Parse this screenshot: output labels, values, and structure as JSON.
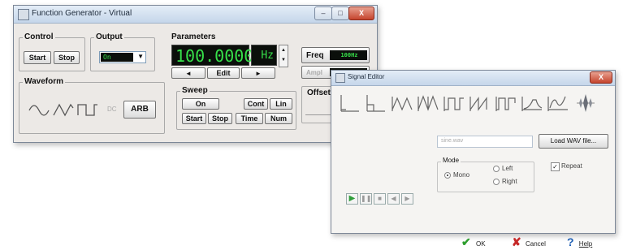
{
  "fg": {
    "title": "Function Generator - Virtual",
    "window_buttons": {
      "min": "–",
      "max": "□",
      "close": "X"
    },
    "control": {
      "label": "Control",
      "start": "Start",
      "stop": "Stop"
    },
    "output": {
      "label": "Output",
      "value": "On"
    },
    "waveform": {
      "label": "Waveform",
      "dc": "DC",
      "arb": "ARB"
    },
    "parameters": {
      "label": "Parameters",
      "display": "100.0000",
      "unit": "Hz",
      "left": "◄",
      "edit": "Edit",
      "right": "►",
      "freq_label": "Freq",
      "freq_value": "100Hz",
      "ampl_label": "Ampl",
      "offset_label": "Offset"
    },
    "sweep": {
      "label": "Sweep",
      "on": "On",
      "cont": "Cont",
      "lin": "Lin",
      "start": "Start",
      "stop": "Stop",
      "time": "Time",
      "num": "Num"
    }
  },
  "se": {
    "title": "Signal Editor",
    "file_input": "sine.wav",
    "load_button": "Load WAV file...",
    "mode": {
      "label": "Mode",
      "mono": "Mono",
      "left": "Left",
      "right": "Right",
      "selected": "Mono"
    },
    "repeat": {
      "label": "Repeat",
      "checked": true
    },
    "footer": {
      "ok": "OK",
      "cancel": "Cancel",
      "help": "Help"
    }
  },
  "colors": {
    "lcd_green": "#37e04a",
    "lcd_bg": "#0b0f0b",
    "ok_green": "#2e9e2e",
    "cancel_red": "#c62828",
    "help_blue": "#1f5fb4",
    "play_green": "#2f9e3a"
  }
}
